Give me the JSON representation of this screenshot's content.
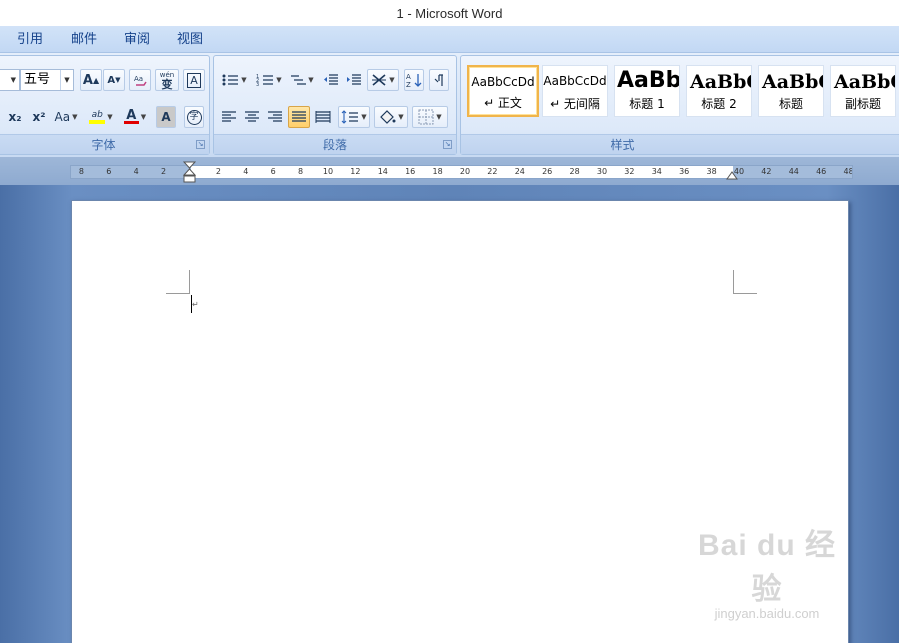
{
  "window": {
    "title": "1 - Microsoft Word"
  },
  "tabs": [
    {
      "label": "引用"
    },
    {
      "label": "邮件"
    },
    {
      "label": "审阅"
    },
    {
      "label": "视图"
    }
  ],
  "font_group": {
    "label": "字体",
    "font_size": "五号",
    "grow_label": "A",
    "shrink_label": "A",
    "phonetic_label": "wén",
    "phonetic_char": "变",
    "border_char_label": "A",
    "subscript_label": "x₂",
    "superscript_label": "x²",
    "case_label": "Aa",
    "highlight_label": "ab",
    "font_color_label": "A",
    "shading_label": "A",
    "enclose_label": "字"
  },
  "paragraph_group": {
    "label": "段落"
  },
  "styles_group": {
    "label": "样式",
    "items": [
      {
        "sample": "AaBbCcDd",
        "name": "↵ 正文",
        "selected": true
      },
      {
        "sample": "AaBbCcDd",
        "name": "↵ 无间隔",
        "selected": false
      },
      {
        "sample": "AaBb",
        "name": "标题 1",
        "selected": false
      },
      {
        "sample": "AaBbC",
        "name": "标题 2",
        "selected": false
      },
      {
        "sample": "AaBbC",
        "name": "标题",
        "selected": false
      },
      {
        "sample": "AaBbC",
        "name": "副标题",
        "selected": false
      }
    ]
  },
  "ruler": {
    "left_ticks": [
      "8",
      "6",
      "4",
      "2"
    ],
    "right_ticks": [
      "2",
      "4",
      "6",
      "8",
      "10",
      "12",
      "14",
      "16",
      "18",
      "20",
      "22",
      "24",
      "26",
      "28",
      "30",
      "32",
      "34",
      "36",
      "38",
      "40",
      "42",
      "44",
      "46",
      "48"
    ]
  },
  "watermark": {
    "main": "Bai du 经验",
    "sub": "jingyan.baidu.com"
  },
  "colors": {
    "accent": "#f0b44b",
    "highlight": "#ffff00",
    "font_color": "#e00000",
    "ribbon_text": "#15428b"
  }
}
